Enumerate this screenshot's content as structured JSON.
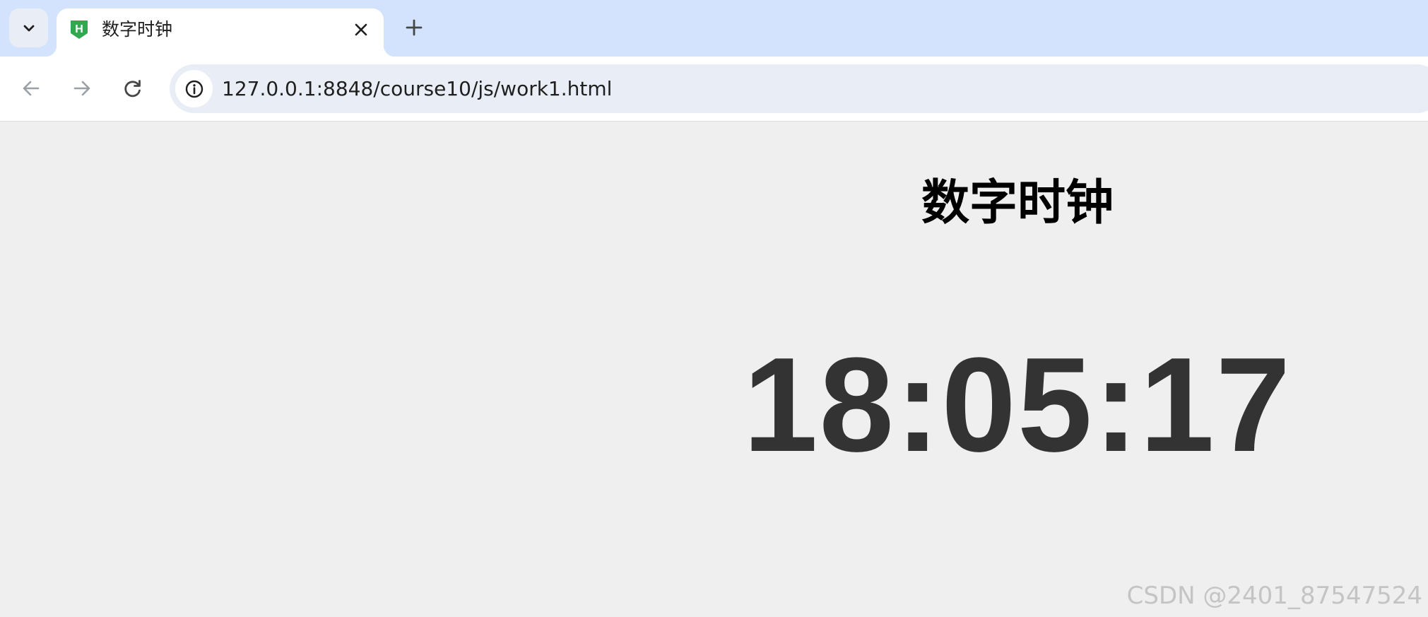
{
  "browser": {
    "tab": {
      "title": "数字时钟",
      "favicon_letter": "H",
      "favicon_color": "#2fa84f"
    },
    "toolbar": {
      "url": "127.0.0.1:8848/course10/js/work1.html"
    },
    "accent_color": "#d3e3fd"
  },
  "page": {
    "heading": "数字时钟",
    "clock_time": "18:05:17",
    "watermark": "CSDN @2401_87547524"
  }
}
